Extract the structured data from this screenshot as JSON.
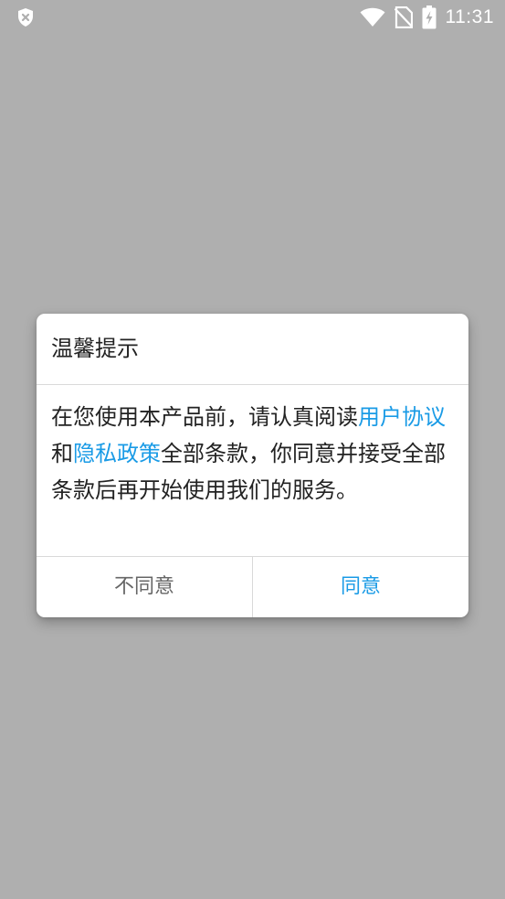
{
  "status_bar": {
    "time": "11:31",
    "left_icon": "shield-x-icon",
    "icons": [
      "wifi-icon",
      "no-sim-icon",
      "battery-charging-icon"
    ]
  },
  "dialog": {
    "title": "温馨提示",
    "body": {
      "text1": "在您使用本产品前，请认真阅读",
      "link_user_agreement": "用户协议",
      "text2": "和",
      "link_privacy_policy": "隐私政策",
      "text3": "全部条款，你同意并接受全部条款后再开始使用我们的服务。"
    },
    "disagree_label": "不同意",
    "agree_label": "同意"
  },
  "colors": {
    "overlay_background": "#afafaf",
    "link": "#1a9be6",
    "dialog_background": "#ffffff"
  }
}
